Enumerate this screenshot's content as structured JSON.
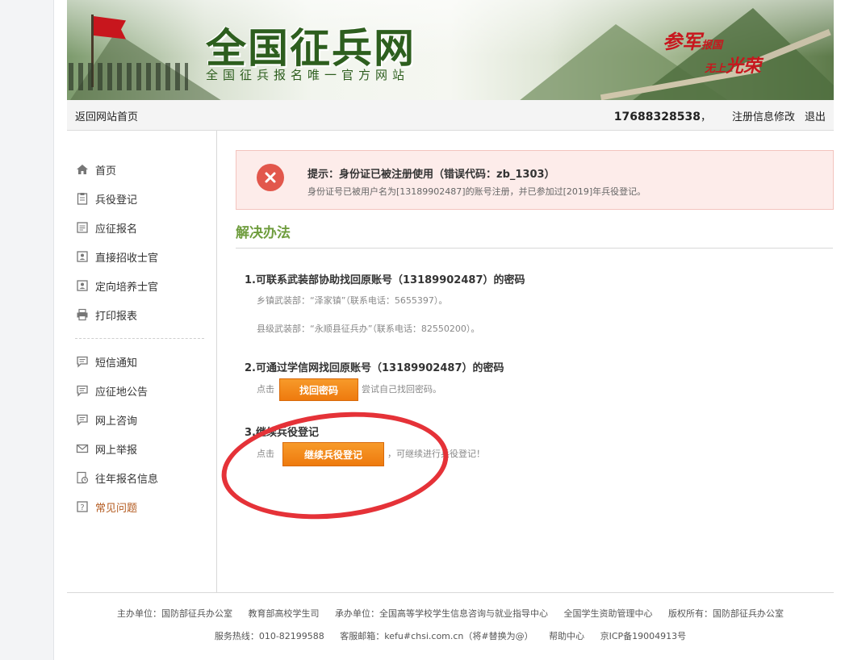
{
  "banner": {
    "title": "全国征兵网",
    "subtitle": "全国征兵报名唯一官方网站",
    "slogan_line1_big": "参军",
    "slogan_line1_small": "报国",
    "slogan_line2_small": "无上",
    "slogan_line2_big": "光荣"
  },
  "topbar": {
    "home_link": "返回网站首页",
    "phone": "17688328538",
    "comma": "，",
    "edit_link": "注册信息修改",
    "logout_link": "退出"
  },
  "sidebar": {
    "items": [
      {
        "label": "首页",
        "icon": "home-icon"
      },
      {
        "label": "兵役登记",
        "icon": "clipboard-icon"
      },
      {
        "label": "应征报名",
        "icon": "document-icon"
      },
      {
        "label": "直接招收士官",
        "icon": "id-card-icon"
      },
      {
        "label": "定向培养士官",
        "icon": "id-card-icon"
      },
      {
        "label": "打印报表",
        "icon": "printer-icon"
      }
    ],
    "items2": [
      {
        "label": "短信通知",
        "icon": "message-icon"
      },
      {
        "label": "应征地公告",
        "icon": "message-icon"
      },
      {
        "label": "网上咨询",
        "icon": "message-icon"
      },
      {
        "label": "网上举报",
        "icon": "mail-icon"
      },
      {
        "label": "往年报名信息",
        "icon": "history-icon"
      },
      {
        "label": "常见问题",
        "icon": "question-icon"
      }
    ]
  },
  "alert": {
    "title": "提示：身份证已被注册使用（错误代码：zb_1303）",
    "desc": "身份证号已被用户名为[13189902487]的账号注册，并已参加过[2019]年兵役登记。"
  },
  "solution": {
    "heading": "解决办法",
    "step1_title": "1.可联系武装部协助找回原账号（13189902487）的密码",
    "step1_line1": "乡镇武装部：“泽家镇”（联系电话：5655397）。",
    "step1_line2": "县级武装部：“永顺县征兵办”（联系电话：82550200）。",
    "step2_title": "2.可通过学信网找回原账号（13189902487）的密码",
    "step2_prefix": "点击",
    "step2_button": "找回密码",
    "step2_suffix": "尝试自己找回密码。",
    "step3_title": "3.继续兵役登记",
    "step3_prefix": "点击",
    "step3_button": "继续兵役登记",
    "step3_suffix": "，可继续进行兵役登记！"
  },
  "footer": {
    "line1": [
      "主办单位：国防部征兵办公室",
      "教育部高校学生司",
      "承办单位：全国高等学校学生信息咨询与就业指导中心",
      "全国学生资助管理中心",
      "版权所有：国防部征兵办公室"
    ],
    "line2": [
      "服务热线：010-82199588",
      "客服邮箱：kefu#chsi.com.cn（将#替换为@）",
      "帮助中心",
      "京ICP备19004913号"
    ]
  },
  "colors": {
    "accent_green": "#6f9d3e",
    "button_orange": "#ee7a0e",
    "alert_bg": "#fdecea",
    "annotation_red": "#e53238"
  }
}
